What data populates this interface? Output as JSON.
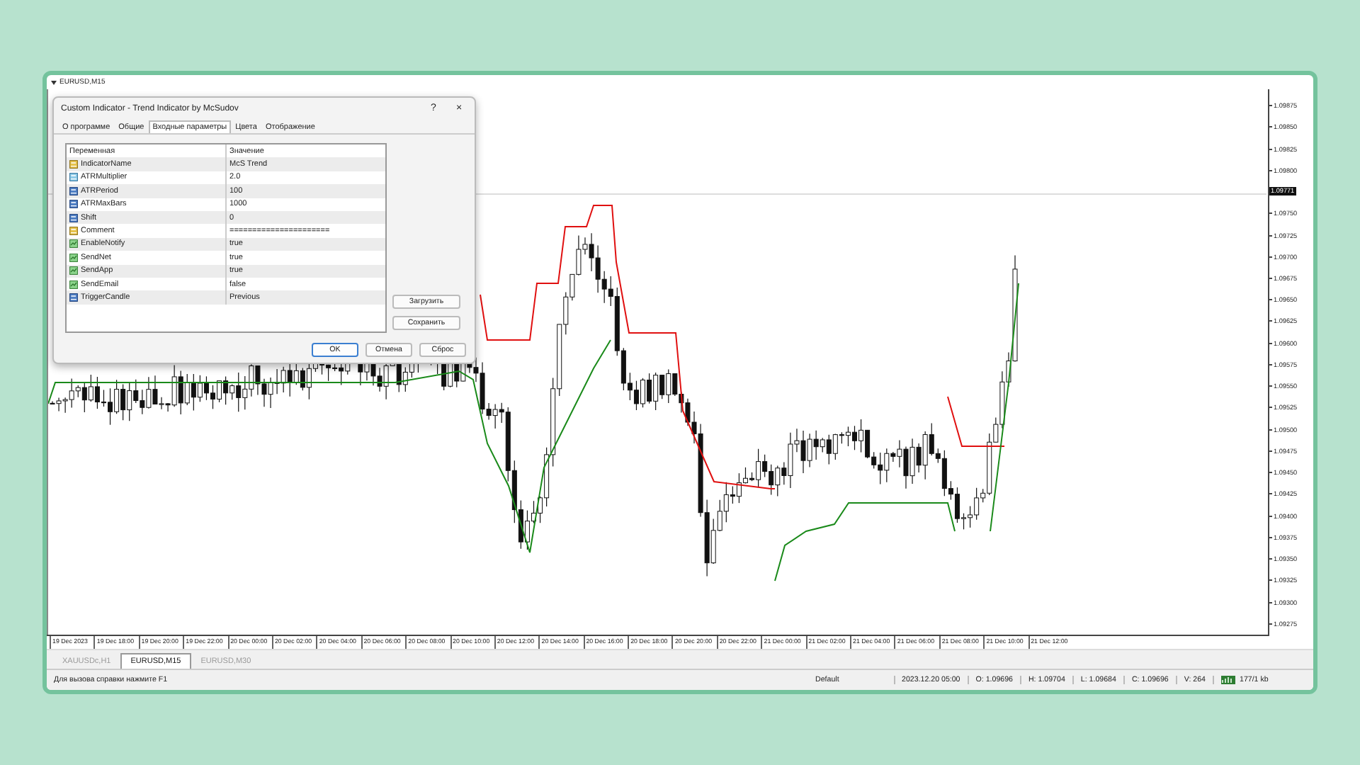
{
  "chart": {
    "title": "EURUSD,M15",
    "price_axis": [
      "1.09875",
      "1.09850",
      "1.09825",
      "1.09800",
      {
        "kind": "current",
        "label": "1.09771"
      },
      "1.09750",
      "1.09725",
      "1.09700",
      "1.09675",
      "1.09650",
      "1.09625",
      "1.09600",
      "1.09575",
      "1.09550",
      "1.09525",
      "1.09500",
      "1.09475",
      "1.09450",
      "1.09425",
      "1.09400",
      "1.09375",
      "1.09350",
      "1.09325",
      "1.09300",
      "1.09275"
    ],
    "time_axis": [
      "19 Dec 2023",
      "19 Dec 18:00",
      "19 Dec 20:00",
      "19 Dec 22:00",
      "20 Dec 00:00",
      "20 Dec 02:00",
      "20 Dec 04:00",
      "20 Dec 06:00",
      "20 Dec 08:00",
      "20 Dec 10:00",
      "20 Dec 12:00",
      "20 Dec 14:00",
      "20 Dec 16:00",
      "20 Dec 18:00",
      "20 Dec 20:00",
      "20 Dec 22:00",
      "21 Dec 00:00",
      "21 Dec 02:00",
      "21 Dec 04:00",
      "21 Dec 06:00",
      "21 Dec 08:00",
      "21 Dec 10:00",
      "21 Dec 12:00"
    ]
  },
  "dialog": {
    "title": "Custom Indicator - Trend Indicator by McSudov",
    "help": "?",
    "close": "×",
    "tabs": [
      {
        "label": "О программе",
        "selected": false
      },
      {
        "label": "Общие",
        "selected": false
      },
      {
        "label": "Входные параметры",
        "selected": true
      },
      {
        "label": "Цвета",
        "selected": false
      },
      {
        "label": "Отображение",
        "selected": false
      }
    ],
    "columns": [
      "Переменная",
      "Значение"
    ],
    "rows": [
      {
        "kind": "string",
        "name": "IndicatorName",
        "value": "McS Trend"
      },
      {
        "kind": "double",
        "name": "ATRMultiplier",
        "value": "2.0"
      },
      {
        "kind": "int",
        "name": "ATRPeriod",
        "value": "100"
      },
      {
        "kind": "int",
        "name": "ATRMaxBars",
        "value": "1000"
      },
      {
        "kind": "int",
        "name": "Shift",
        "value": "0"
      },
      {
        "kind": "string",
        "name": "Comment",
        "value": "======================"
      },
      {
        "kind": "bool",
        "name": "EnableNotify",
        "value": "true"
      },
      {
        "kind": "bool",
        "name": "SendNet",
        "value": "true"
      },
      {
        "kind": "bool",
        "name": "SendApp",
        "value": "true"
      },
      {
        "kind": "bool",
        "name": "SendEmail",
        "value": "false"
      },
      {
        "kind": "int",
        "name": "TriggerCandle",
        "value": "Previous"
      }
    ],
    "side_buttons": [
      "Загрузить",
      "Сохранить"
    ],
    "buttons": [
      {
        "label": "OK",
        "default": true
      },
      {
        "label": "Отмена",
        "default": false
      },
      {
        "label": "Сброс",
        "default": false
      }
    ]
  },
  "chart_tabs": [
    {
      "label": "XAUUSDc,H1",
      "selected": false
    },
    {
      "label": "EURUSD,M15",
      "selected": true
    },
    {
      "label": "EURUSD,M30",
      "selected": false
    }
  ],
  "status_bar": {
    "help": "Для вызова справки нажмите F1",
    "profile": "Default",
    "time": "2023.12.20 05:00",
    "open": "O: 1.09696",
    "high": "H: 1.09704",
    "low": "L: 1.09684",
    "close": "C: 1.09696",
    "volume": "V: 264",
    "traffic": "177/1 kb"
  }
}
